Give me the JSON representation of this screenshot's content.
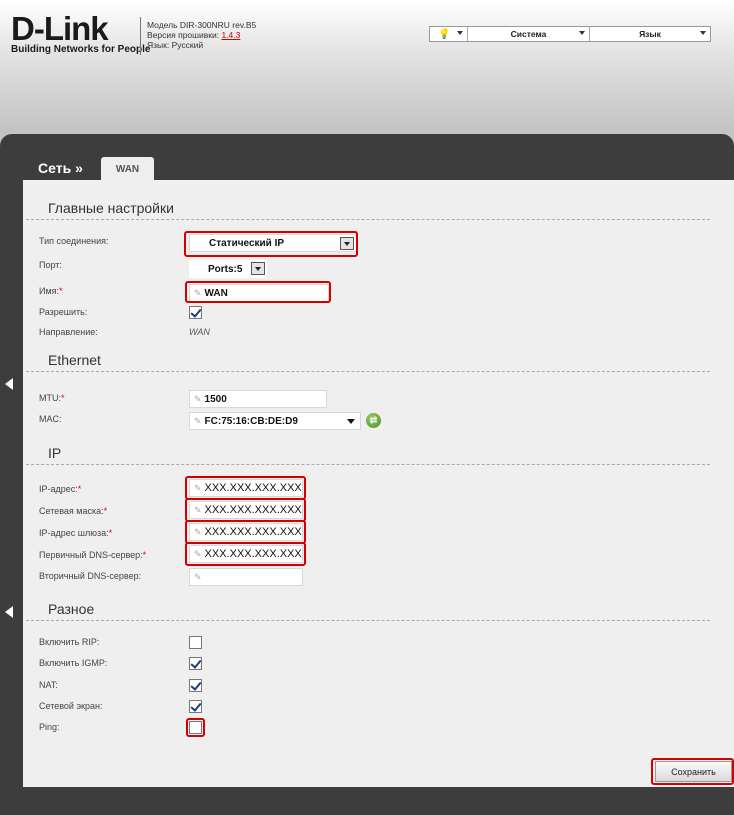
{
  "header": {
    "logo_main": "D-Link",
    "logo_sub": "Building Networks for People",
    "model_line": "Модель DIR-300NRU rev.B5",
    "firmware_label": "Версия прошивки:",
    "firmware_value": "1.4.3",
    "language_line": "Язык: Русский",
    "menu_system": "Система",
    "menu_language": "Язык"
  },
  "breadcrumb": {
    "section": "Сеть »",
    "tab": "WAN"
  },
  "sections": {
    "main": "Главные настройки",
    "ethernet": "Ethernet",
    "ip": "IP",
    "misc": "Разное"
  },
  "main_settings": {
    "conn_type_label": "Тип соединения:",
    "conn_type_value": "Статический IP",
    "port_label": "Порт:",
    "port_value": "Ports:5",
    "name_label": "Имя:",
    "name_value": "WAN",
    "enable_label": "Разрешить:",
    "enable_checked": true,
    "direction_label": "Направление:",
    "direction_value": "WAN"
  },
  "ethernet": {
    "mtu_label": "MTU:",
    "mtu_value": "1500",
    "mac_label": "MAC:",
    "mac_value": "FC:75:16:CB:DE:D9"
  },
  "ip": {
    "ip_label": "IP-адрес:",
    "ip_value": "XXX.XXX.XXX.XXX",
    "mask_label": "Сетевая маска:",
    "mask_value": "XXX.XXX.XXX.XXX",
    "gateway_label": "IP-адрес шлюза:",
    "gateway_value": "XXX.XXX.XXX.XXX",
    "dns1_label": "Первичный DNS-сервер:",
    "dns1_value": "XXX.XXX.XXX.XXX",
    "dns2_label": "Вторичный DNS-сервер:",
    "dns2_value": ""
  },
  "misc": {
    "rip_label": "Включить RIP:",
    "rip_checked": false,
    "igmp_label": "Включить IGMP:",
    "igmp_checked": true,
    "nat_label": "NAT:",
    "nat_checked": true,
    "firewall_label": "Сетевой экран:",
    "firewall_checked": true,
    "ping_label": "Ping:",
    "ping_checked": false
  },
  "required_mark": "*",
  "save_label": "Сохранить",
  "colors": {
    "highlight": "#d40000",
    "panel_dark": "#3d3d3d",
    "content_bg": "#efefef"
  },
  "icons": [
    "lightbulb-icon",
    "chevron-down-icon",
    "pencil-icon",
    "refresh-icon",
    "chevron-left-icon"
  ]
}
